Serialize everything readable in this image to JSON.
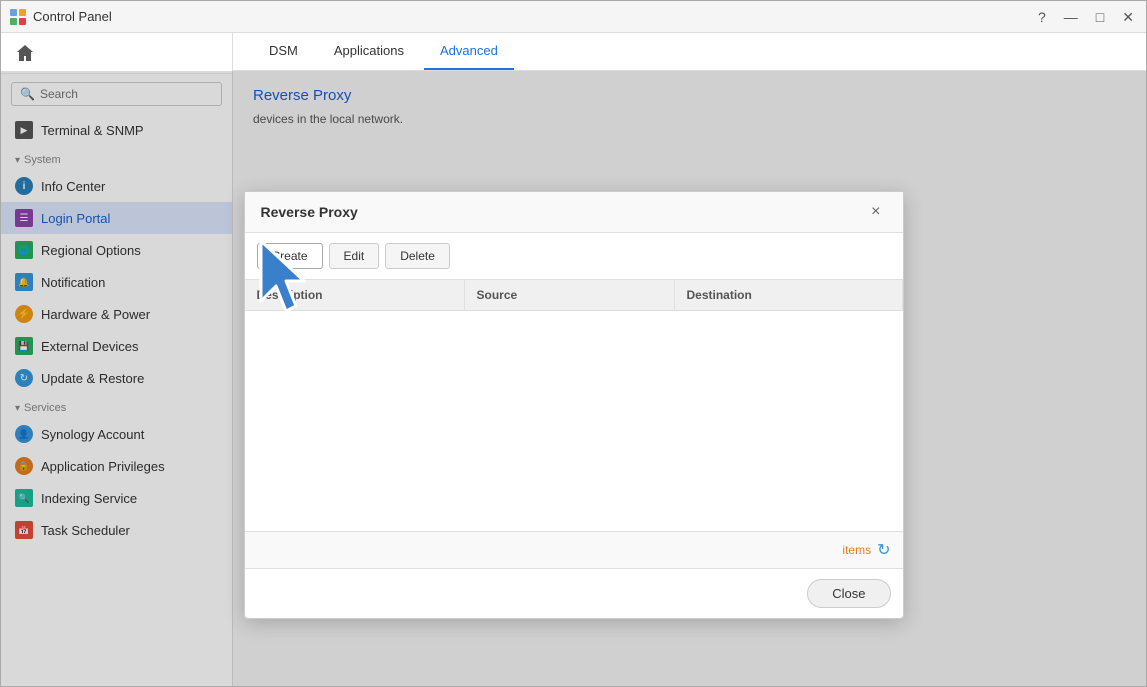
{
  "window": {
    "title": "Control Panel",
    "controls": {
      "help": "?",
      "minimize": "—",
      "maximize": "□",
      "close": "✕"
    }
  },
  "sidebar": {
    "search_placeholder": "Search",
    "home_icon": "home-icon",
    "terminal_item": "Terminal & SNMP",
    "system_section": "System",
    "items": [
      {
        "id": "info-center",
        "label": "Info Center",
        "icon": "info-icon"
      },
      {
        "id": "login-portal",
        "label": "Login Portal",
        "icon": "login-icon",
        "active": true
      },
      {
        "id": "regional-options",
        "label": "Regional Options",
        "icon": "regional-icon"
      },
      {
        "id": "notification",
        "label": "Notification",
        "icon": "notification-icon"
      },
      {
        "id": "hardware-power",
        "label": "Hardware & Power",
        "icon": "hardware-icon"
      },
      {
        "id": "external-devices",
        "label": "External Devices",
        "icon": "external-icon"
      },
      {
        "id": "update-restore",
        "label": "Update & Restore",
        "icon": "update-icon"
      }
    ],
    "services_section": "Services",
    "services_items": [
      {
        "id": "synology-account",
        "label": "Synology Account",
        "icon": "synology-icon"
      },
      {
        "id": "app-privileges",
        "label": "Application Privileges",
        "icon": "apppriv-icon"
      },
      {
        "id": "indexing-service",
        "label": "Indexing Service",
        "icon": "indexing-icon"
      },
      {
        "id": "task-scheduler",
        "label": "Task Scheduler",
        "icon": "task-icon"
      }
    ]
  },
  "tabs": {
    "dsm": "DSM",
    "applications": "Applications",
    "advanced": "Advanced"
  },
  "main": {
    "page_title": "Reverse Proxy",
    "description": "devices in the local network."
  },
  "modal": {
    "title": "Reverse Proxy",
    "buttons": {
      "create": "Create",
      "edit": "Edit",
      "delete": "Delete",
      "close": "Close"
    },
    "table": {
      "columns": [
        "Description",
        "Source",
        "Destination"
      ]
    },
    "footer": {
      "items_label": "items",
      "refresh_icon": "↻"
    }
  }
}
